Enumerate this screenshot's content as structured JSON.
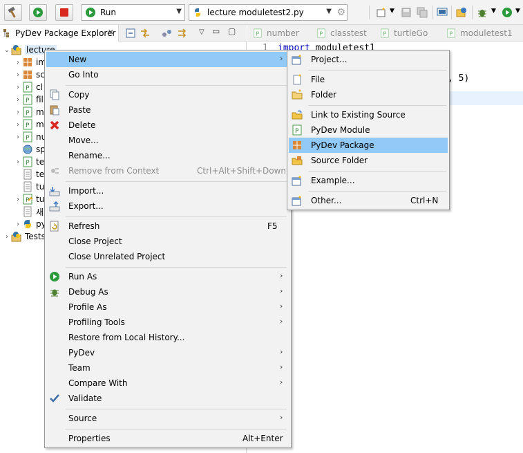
{
  "toolbar": {
    "run_config": "Run",
    "file_combo": "lecture moduletest2.py"
  },
  "explorer": {
    "title": "PyDev Package Explorer",
    "tree": [
      {
        "label": "lecture",
        "icon": "pydev-project-icon",
        "expanded": true
      },
      {
        "label": "im",
        "icon": "package-icon"
      },
      {
        "label": "sc",
        "icon": "package-icon"
      },
      {
        "label": "cl",
        "icon": "python-file-icon"
      },
      {
        "label": "fil",
        "icon": "python-file-icon"
      },
      {
        "label": "m",
        "icon": "python-file-icon"
      },
      {
        "label": "m",
        "icon": "python-file-icon"
      },
      {
        "label": "nu",
        "icon": "python-file-icon"
      },
      {
        "label": "sp",
        "icon": "globe-icon"
      },
      {
        "label": "te",
        "icon": "python-file-icon"
      },
      {
        "label": "te",
        "icon": "text-file-icon"
      },
      {
        "label": "tu",
        "icon": "text-file-icon"
      },
      {
        "label": "tu",
        "icon": "python-file-icon"
      },
      {
        "label": "새",
        "icon": "text-file-icon"
      },
      {
        "label": "py",
        "icon": "python-interpreter-icon"
      },
      {
        "label": "Tests",
        "icon": "pydev-project-icon"
      }
    ]
  },
  "editor": {
    "tabs": [
      "number",
      "classtest",
      "turtleGo",
      "moduletest1"
    ],
    "line_number": "1",
    "code_line1_keyword": "import",
    "code_line1_rest": " moduletest1",
    "code_fragment": ", 5)"
  },
  "context_menu": {
    "items": [
      {
        "label": "New",
        "submenu": true,
        "highlight": true
      },
      {
        "label": "Go Into"
      },
      {
        "separator": true
      },
      {
        "label": "Copy",
        "icon": "copy-icon"
      },
      {
        "label": "Paste",
        "icon": "paste-icon"
      },
      {
        "label": "Delete",
        "icon": "delete-icon"
      },
      {
        "label": "Move..."
      },
      {
        "label": "Rename..."
      },
      {
        "label": "Remove from Context",
        "shortcut": "Ctrl+Alt+Shift+Down",
        "disabled": true,
        "icon": "remove-context-icon"
      },
      {
        "separator": true
      },
      {
        "label": "Import...",
        "icon": "import-icon"
      },
      {
        "label": "Export...",
        "icon": "export-icon"
      },
      {
        "separator": true
      },
      {
        "label": "Refresh",
        "shortcut": "F5",
        "icon": "refresh-icon"
      },
      {
        "label": "Close Project"
      },
      {
        "label": "Close Unrelated Project"
      },
      {
        "separator": true
      },
      {
        "label": "Run As",
        "submenu": true,
        "icon": "run-icon"
      },
      {
        "label": "Debug As",
        "submenu": true,
        "icon": "debug-icon"
      },
      {
        "label": "Profile As",
        "submenu": true
      },
      {
        "label": "Profiling Tools",
        "submenu": true
      },
      {
        "label": "Restore from Local History..."
      },
      {
        "label": "PyDev",
        "submenu": true
      },
      {
        "label": "Team",
        "submenu": true
      },
      {
        "label": "Compare With",
        "submenu": true
      },
      {
        "label": "Validate",
        "icon": "check-icon"
      },
      {
        "separator": true
      },
      {
        "label": "Source",
        "submenu": true
      },
      {
        "separator": true
      },
      {
        "label": "Properties",
        "shortcut": "Alt+Enter"
      }
    ]
  },
  "new_submenu": {
    "items": [
      {
        "label": "Project...",
        "icon": "new-project-icon"
      },
      {
        "separator": true
      },
      {
        "label": "File",
        "icon": "new-file-icon"
      },
      {
        "label": "Folder",
        "icon": "folder-icon"
      },
      {
        "separator": true
      },
      {
        "label": "Link to Existing Source",
        "icon": "link-source-icon"
      },
      {
        "label": "PyDev Module",
        "icon": "pydev-module-icon"
      },
      {
        "label": "PyDev Package",
        "icon": "pydev-package-icon",
        "highlight": true
      },
      {
        "label": "Source Folder",
        "icon": "source-folder-icon"
      },
      {
        "separator": true
      },
      {
        "label": "Example...",
        "icon": "example-icon"
      },
      {
        "separator": true
      },
      {
        "label": "Other...",
        "shortcut": "Ctrl+N",
        "icon": "other-wizard-icon"
      }
    ]
  },
  "colors": {
    "highlight": "#91c9f7",
    "menu_bg": "#f2f2f2",
    "keyword": "#0000c0",
    "run_green": "#2a9a3a",
    "stop_red": "#d9281f"
  }
}
